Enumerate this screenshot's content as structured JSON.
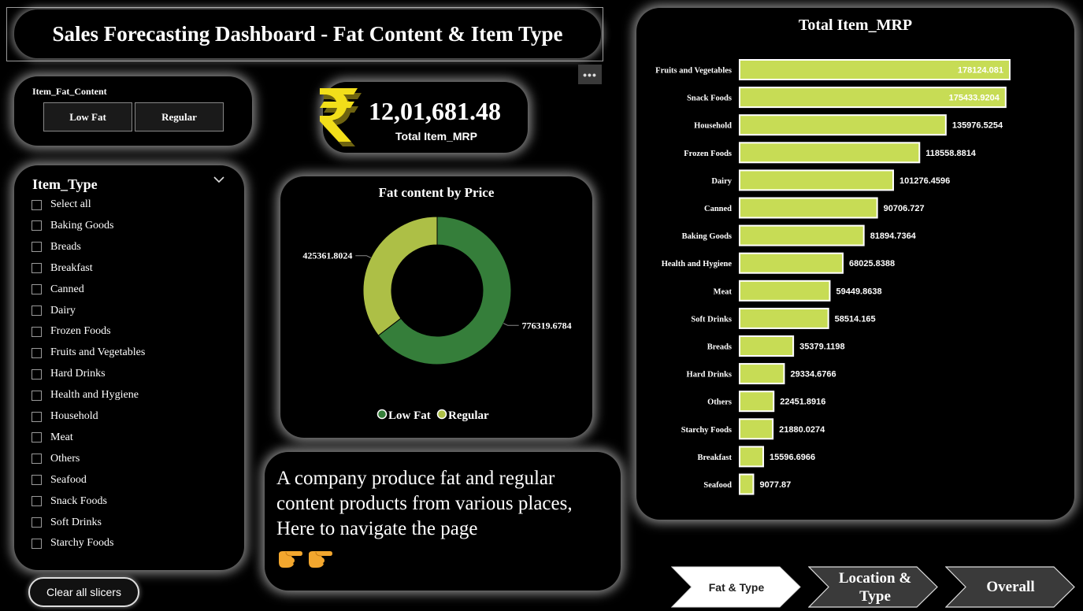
{
  "title": "Sales Forecasting Dashboard - Fat Content & Item Type",
  "more_options": "•••",
  "fat_slicer": {
    "label": "Item_Fat_Content",
    "options": [
      "Low Fat",
      "Regular"
    ]
  },
  "kpi": {
    "value": "12,01,681.48",
    "caption": "Total Item_MRP"
  },
  "type_slicer": {
    "header": "Item_Type",
    "options": [
      "Select all",
      "Baking Goods",
      "Breads",
      "Breakfast",
      "Canned",
      "Dairy",
      "Frozen Foods",
      "Fruits and Vegetables",
      "Hard Drinks",
      "Health and Hygiene",
      "Household",
      "Meat",
      "Others",
      "Seafood",
      "Snack Foods",
      "Soft Drinks",
      "Starchy Foods"
    ]
  },
  "clear_button": "Clear all slicers",
  "description": "A company produce fat and regular content products from various places, Here to navigate the page",
  "nav": {
    "items": [
      "Fat & Type",
      "Location & Type",
      "Overall"
    ]
  },
  "colors": {
    "low_fat": "#357e3a",
    "regular": "#adbf46",
    "bar": "#c7dc55",
    "background": "#000000"
  },
  "chart_data": [
    {
      "type": "pie",
      "title": "Fat content by Price",
      "labels": [
        "Low Fat",
        "Regular"
      ],
      "values": [
        776319.6784,
        425361.8024
      ],
      "data_labels": [
        "776319.6784",
        "425361.8024"
      ],
      "legend": "bottom",
      "colors": [
        "#357e3a",
        "#adbf46"
      ]
    },
    {
      "type": "bar",
      "orientation": "horizontal",
      "title": "Total Item_MRP",
      "categories": [
        "Fruits and Vegetables",
        "Snack Foods",
        "Household",
        "Frozen Foods",
        "Dairy",
        "Canned",
        "Baking Goods",
        "Health and Hygiene",
        "Meat",
        "Soft Drinks",
        "Breads",
        "Hard Drinks",
        "Others",
        "Starchy Foods",
        "Breakfast",
        "Seafood"
      ],
      "values": [
        178124.081,
        175433.9204,
        135976.5254,
        118558.8814,
        101276.4596,
        90706.727,
        81894.7364,
        68025.8388,
        59449.8638,
        58514.165,
        35379.1198,
        29334.6766,
        22451.8916,
        21880.0274,
        15596.6966,
        9077.87
      ],
      "data_labels": [
        "178124.081",
        "175433.9204",
        "135976.5254",
        "118558.8814",
        "101276.4596",
        "90706.727",
        "81894.7364",
        "68025.8388",
        "59449.8638",
        "58514.165",
        "35379.1198",
        "29334.6766",
        "22451.8916",
        "21880.0274",
        "15596.6966",
        "9077.87"
      ],
      "grid": false,
      "color": "#c7dc55"
    }
  ]
}
